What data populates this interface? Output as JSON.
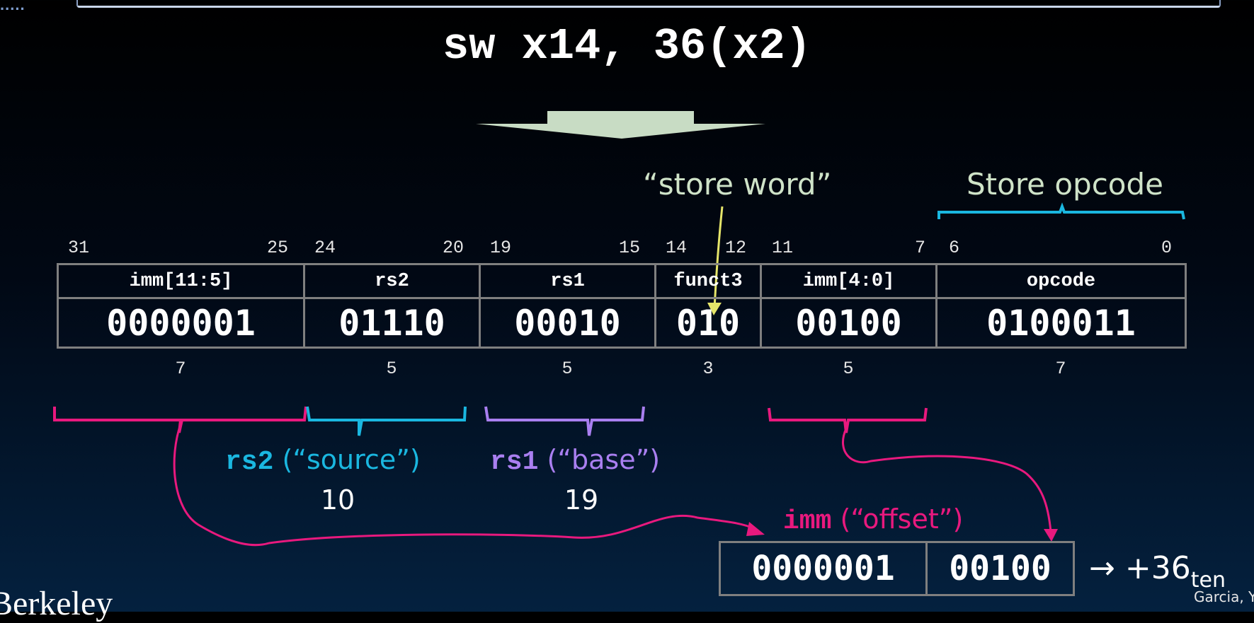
{
  "title": "sw x14, 36(x2)",
  "colors": {
    "background_top": "#000000",
    "background_bottom": "#04213f",
    "arrow_fill": "#c8dcc4",
    "label_green": "#cfe3c8",
    "pink": "#e8197e",
    "cyan": "#1ab7e0",
    "purple": "#a97ff0",
    "yellow": "#e5e56a",
    "cell_border": "#7f7f7f"
  },
  "labels": {
    "store_word": "“store word”",
    "store_opcode": "Store opcode"
  },
  "bit_positions": [
    "31",
    "25",
    "24",
    "20",
    "19",
    "15",
    "14",
    "12",
    "11",
    "7",
    "6",
    "0"
  ],
  "fields": [
    {
      "name": "imm[11:5]",
      "value": "0000001",
      "width": "7"
    },
    {
      "name": "rs2",
      "value": "01110",
      "width": "5"
    },
    {
      "name": "rs1",
      "value": "00010",
      "width": "5"
    },
    {
      "name": "funct3",
      "value": "010",
      "width": "3"
    },
    {
      "name": "imm[4:0]",
      "value": "00100",
      "width": "5"
    },
    {
      "name": "opcode",
      "value": "0100011",
      "width": "7"
    }
  ],
  "annotations": {
    "rs2": {
      "name": "rs2",
      "role": " (“source”)",
      "value": "10"
    },
    "rs1": {
      "name": "rs1",
      "role": " (“base”)",
      "value": "19"
    },
    "imm": {
      "name": "imm",
      "role": " (“offset”)"
    }
  },
  "immediate": {
    "high": "0000001",
    "low": "00100",
    "arrow": "→",
    "result": "+36",
    "result_subscript": "ten"
  },
  "footer": {
    "credit": "Garcia, Y",
    "logo": "Berkeley",
    "corner_marks": "....."
  }
}
